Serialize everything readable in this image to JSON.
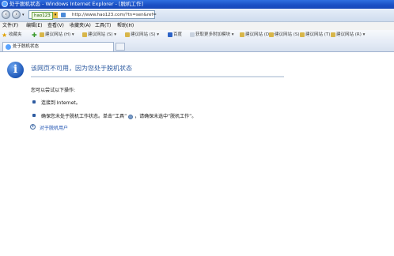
{
  "window": {
    "title": "处于脱机状态 - Windows Internet Explorer - [脱机工作]"
  },
  "address": {
    "badge": "hao123",
    "url": "http://www.hao123.com/?tn=sen&ref="
  },
  "menu": [
    "文件(F)",
    "编辑(E)",
    "查看(V)",
    "收藏夹(A)",
    "工具(T)",
    "帮助(H)"
  ],
  "favorites": {
    "label": "收藏夹",
    "items": [
      "建议网站 (H) ▾",
      "建议网站 (S) ▾",
      "建议网站 (S) ▾",
      "百度",
      "获取更多附加模块 ▾",
      "建议网站 (D) ▾",
      "建议网站 (S) ▾",
      "建议网站 (T) ▾",
      "建议网站 (R) ▾"
    ]
  },
  "tab": {
    "label": "处于脱机状态"
  },
  "content": {
    "heading": "该网页不可用，因为您处于脱机状态",
    "lead": "您可以尝试以下操作:",
    "item1": "连接到 Internet。",
    "item2_a": "确保您未处于脱机工作状态。单击“工具”",
    "item2_b": "，请确保未选中“脱机工作”。",
    "more_link": "对于脱机用户"
  },
  "colors": {
    "accent": "#2c5aa0",
    "title_bar": "#1a4fc4"
  }
}
